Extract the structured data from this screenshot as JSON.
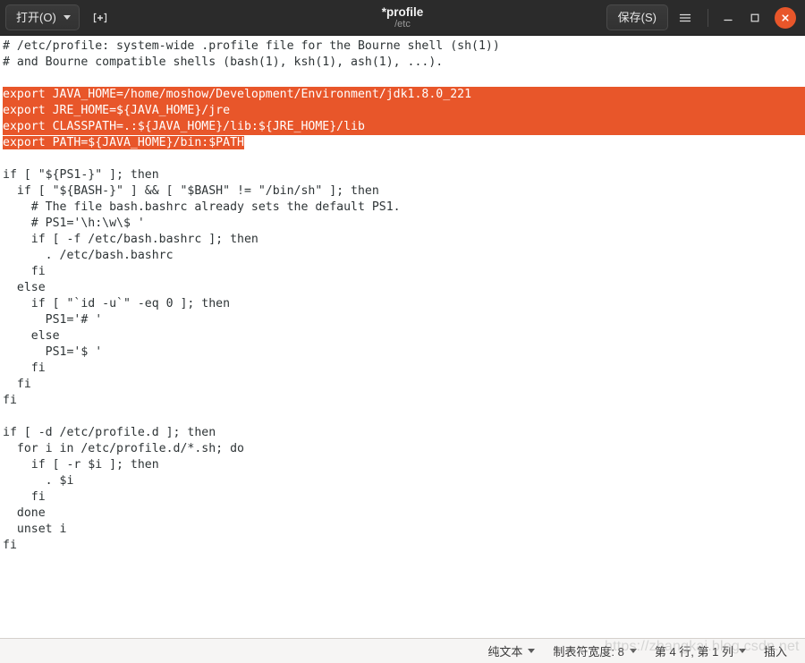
{
  "window": {
    "title": "*profile",
    "subtitle": "/etc",
    "accent_color": "#e8562a",
    "headerbar_color": "#2b2b2b"
  },
  "toolbar": {
    "open_label": "打开(O)",
    "new_tab_icon": "new-document-icon",
    "save_label": "保存(S)",
    "menu_icon": "hamburger-menu-icon",
    "minimize_icon": "minimize-icon",
    "maximize_icon": "maximize-icon",
    "close_icon": "close-icon"
  },
  "editor": {
    "lines": [
      {
        "text": "# /etc/profile: system-wide .profile file for the Bourne shell (sh(1))",
        "selected": false
      },
      {
        "text": "# and Bourne compatible shells (bash(1), ksh(1), ash(1), ...).",
        "selected": false
      },
      {
        "text": "",
        "selected": false
      },
      {
        "text": "export JAVA_HOME=/home/moshow/Development/Environment/jdk1.8.0_221",
        "selected": "full"
      },
      {
        "text": "export JRE_HOME=${JAVA_HOME}/jre",
        "selected": "full"
      },
      {
        "text": "export CLASSPATH=.:${JAVA_HOME}/lib:${JRE_HOME}/lib",
        "selected": "full"
      },
      {
        "text": "export PATH=${JAVA_HOME}/bin:$PATH",
        "selected": "text"
      },
      {
        "text": "",
        "selected": false
      },
      {
        "text": "if [ \"${PS1-}\" ]; then",
        "selected": false
      },
      {
        "text": "  if [ \"${BASH-}\" ] && [ \"$BASH\" != \"/bin/sh\" ]; then",
        "selected": false
      },
      {
        "text": "    # The file bash.bashrc already sets the default PS1.",
        "selected": false
      },
      {
        "text": "    # PS1='\\h:\\w\\$ '",
        "selected": false
      },
      {
        "text": "    if [ -f /etc/bash.bashrc ]; then",
        "selected": false
      },
      {
        "text": "      . /etc/bash.bashrc",
        "selected": false
      },
      {
        "text": "    fi",
        "selected": false
      },
      {
        "text": "  else",
        "selected": false
      },
      {
        "text": "    if [ \"`id -u`\" -eq 0 ]; then",
        "selected": false
      },
      {
        "text": "      PS1='# '",
        "selected": false
      },
      {
        "text": "    else",
        "selected": false
      },
      {
        "text": "      PS1='$ '",
        "selected": false
      },
      {
        "text": "    fi",
        "selected": false
      },
      {
        "text": "  fi",
        "selected": false
      },
      {
        "text": "fi",
        "selected": false
      },
      {
        "text": "",
        "selected": false
      },
      {
        "text": "if [ -d /etc/profile.d ]; then",
        "selected": false
      },
      {
        "text": "  for i in /etc/profile.d/*.sh; do",
        "selected": false
      },
      {
        "text": "    if [ -r $i ]; then",
        "selected": false
      },
      {
        "text": "      . $i",
        "selected": false
      },
      {
        "text": "    fi",
        "selected": false
      },
      {
        "text": "  done",
        "selected": false
      },
      {
        "text": "  unset i",
        "selected": false
      },
      {
        "text": "fi",
        "selected": false
      }
    ]
  },
  "statusbar": {
    "syntax_label": "纯文本",
    "tabwidth_label": "制表符宽度: 8",
    "position_label": "第 4 行, 第 1 列",
    "mode_label": "插入",
    "watermark": "https://zhangkai.blog.csdn.net"
  }
}
